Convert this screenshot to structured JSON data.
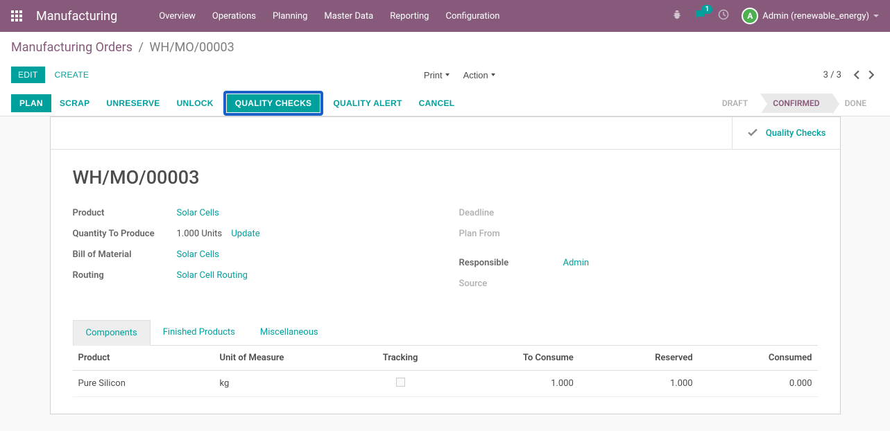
{
  "header": {
    "app_title": "Manufacturing",
    "menu": [
      "Overview",
      "Operations",
      "Planning",
      "Master Data",
      "Reporting",
      "Configuration"
    ],
    "chat_count": "1",
    "user_name": "Admin (renewable_energy)",
    "avatar_letter": "A"
  },
  "breadcrumb": {
    "root": "Manufacturing Orders",
    "current": "WH/MO/00003"
  },
  "control": {
    "edit": "EDIT",
    "create": "CREATE",
    "print": "Print",
    "action": "Action",
    "pager": "3 / 3"
  },
  "actions": {
    "plan": "PLAN",
    "scrap": "SCRAP",
    "unreserve": "UNRESERVE",
    "unlock": "UNLOCK",
    "quality_checks": "QUALITY CHECKS",
    "quality_alert": "QUALITY ALERT",
    "cancel": "CANCEL"
  },
  "status": {
    "draft": "DRAFT",
    "confirmed": "CONFIRMED",
    "done": "DONE"
  },
  "stat_button": {
    "quality_checks": "Quality Checks"
  },
  "record": {
    "title": "WH/MO/00003",
    "labels": {
      "product": "Product",
      "qty": "Quantity To Produce",
      "bom": "Bill of Material",
      "routing": "Routing",
      "deadline": "Deadline",
      "plan_from": "Plan From",
      "responsible": "Responsible",
      "source": "Source"
    },
    "values": {
      "product": "Solar Cells",
      "qty": "1.000 Units",
      "update": "Update",
      "bom": "Solar Cells",
      "routing": "Solar Cell Routing",
      "responsible": "Admin"
    }
  },
  "tabs": {
    "components": "Components",
    "finished": "Finished Products",
    "misc": "Miscellaneous"
  },
  "table": {
    "headers": {
      "product": "Product",
      "uom": "Unit of Measure",
      "tracking": "Tracking",
      "to_consume": "To Consume",
      "reserved": "Reserved",
      "consumed": "Consumed"
    },
    "rows": [
      {
        "product": "Pure Silicon",
        "uom": "kg",
        "to_consume": "1.000",
        "reserved": "1.000",
        "consumed": "0.000"
      }
    ]
  }
}
